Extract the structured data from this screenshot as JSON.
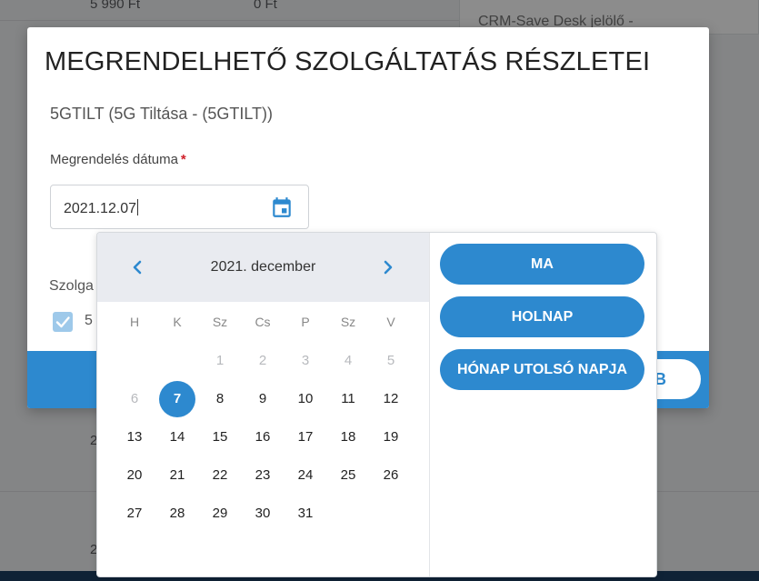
{
  "background": {
    "price_a": "5 990 Ft",
    "price_b": "0 Ft",
    "card_text": "CRM-Save Desk jelölő -",
    "row_fragment_1": "2",
    "row_fragment_2": "2"
  },
  "modal": {
    "title": "MEGRENDELHETŐ SZOLGÁLTATÁS RÉSZLETEI",
    "service_name": "5GTILT (5G Tiltása - (5GTILT))",
    "order_date_label": "Megrendelés dátuma",
    "required_mark": "*",
    "order_date_value": "2021.12.07",
    "section_label": "Szolga",
    "checkbox_label": "5",
    "footer_button_label": "B"
  },
  "datepicker": {
    "month_title": "2021. december",
    "weekdays": [
      "H",
      "K",
      "Sz",
      "Cs",
      "P",
      "Sz",
      "V"
    ],
    "weeks": [
      [
        "",
        "",
        "1",
        "2",
        "3",
        "4",
        "5"
      ],
      [
        "6",
        "7",
        "8",
        "9",
        "10",
        "11",
        "12"
      ],
      [
        "13",
        "14",
        "15",
        "16",
        "17",
        "18",
        "19"
      ],
      [
        "20",
        "21",
        "22",
        "23",
        "24",
        "25",
        "26"
      ],
      [
        "27",
        "28",
        "29",
        "30",
        "31",
        "",
        ""
      ]
    ],
    "disabled_days": [
      "1",
      "2",
      "3",
      "4",
      "5",
      "6"
    ],
    "selected_day": "7",
    "shortcuts": [
      "MA",
      "HOLNAP",
      "HÓNAP UTOLSÓ NAPJA"
    ]
  },
  "colors": {
    "accent": "#2d89cf",
    "header_bg": "#e9ebf0",
    "required": "#d0202a"
  }
}
